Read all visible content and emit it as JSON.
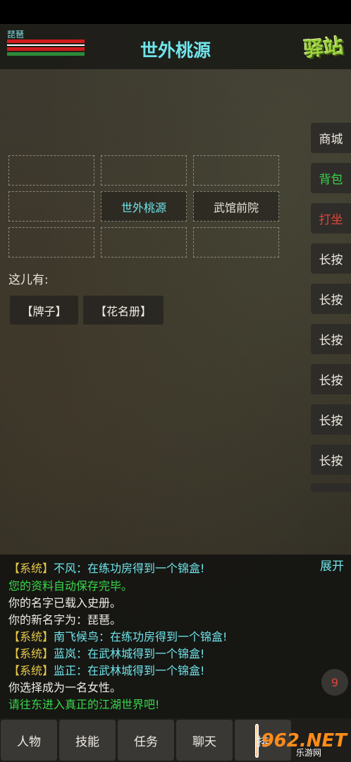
{
  "player": {
    "name": "琵琶"
  },
  "header": {
    "location_title": "世外桃源",
    "logo_text": "驿站"
  },
  "map": {
    "cells": [
      "",
      "",
      "",
      "",
      "世外桃源",
      "武馆前院",
      "",
      "",
      ""
    ]
  },
  "here": {
    "label": "这儿有:",
    "objects": [
      "【牌子】",
      "【花名册】"
    ]
  },
  "side_buttons": [
    {
      "label": "商城",
      "color": "#f0ece4"
    },
    {
      "label": "背包",
      "color": "#37d84a"
    },
    {
      "label": "打坐",
      "color": "#e0443a"
    },
    {
      "label": "长按",
      "color": "#f0ece4"
    },
    {
      "label": "长按",
      "color": "#f0ece4"
    },
    {
      "label": "长按",
      "color": "#f0ece4"
    },
    {
      "label": "长按",
      "color": "#f0ece4"
    },
    {
      "label": "长按",
      "color": "#f0ece4"
    },
    {
      "label": "长按",
      "color": "#f0ece4"
    }
  ],
  "chat": {
    "expand_label": "展开",
    "lines": [
      {
        "tag": "【系统】",
        "text": "不风：在练功房得到一个锦盒!",
        "style": "cyan"
      },
      {
        "tag": "",
        "text": "您的资料自动保存完毕。",
        "style": "green"
      },
      {
        "tag": "",
        "text": "你的名字已载入史册。",
        "style": "white"
      },
      {
        "tag": "",
        "text": "你的新名字为：琵琶。",
        "style": "white"
      },
      {
        "tag": "【系统】",
        "text": "南飞候鸟：在练功房得到一个锦盒!",
        "style": "cyan"
      },
      {
        "tag": "【系统】",
        "text": "蓝岚：在武林城得到一个锦盒!",
        "style": "cyan"
      },
      {
        "tag": "【系统】",
        "text": "监正：在武林城得到一个锦盒!",
        "style": "cyan"
      },
      {
        "tag": "",
        "text": "你选择成为一名女性。",
        "style": "white"
      },
      {
        "tag": "",
        "text": "请往东进入真正的江湖世界吧!",
        "style": "green"
      }
    ],
    "badge_count": "9"
  },
  "bottom_nav": [
    "人物",
    "技能",
    "任务",
    "聊天",
    "排"
  ],
  "watermark": {
    "text": "962.NET",
    "sub": "乐游网"
  }
}
